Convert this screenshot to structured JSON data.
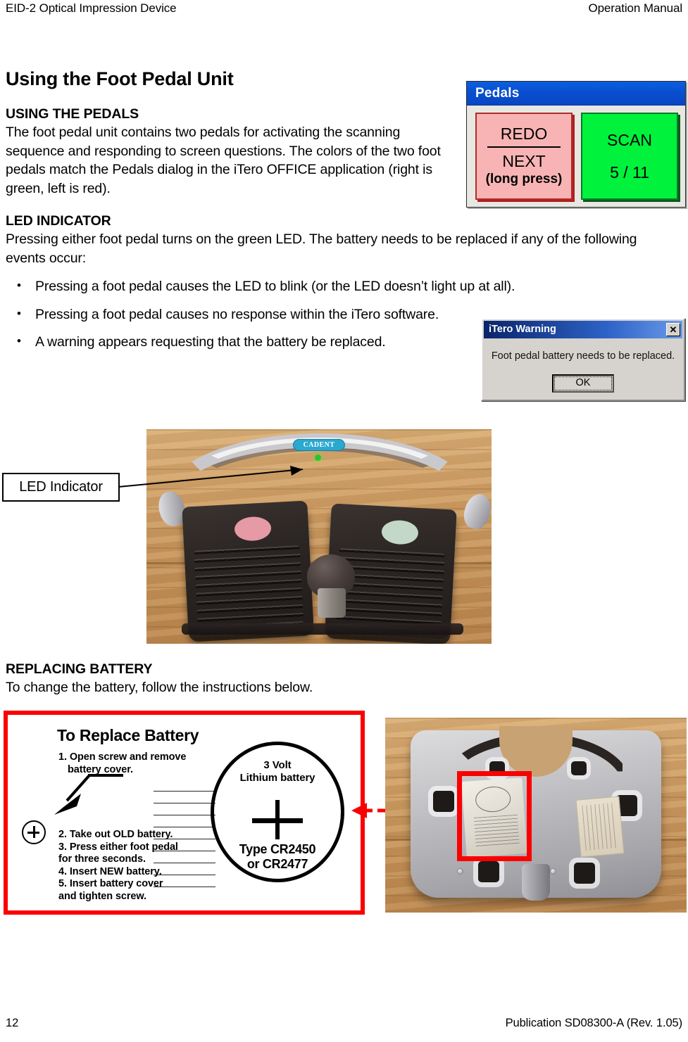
{
  "header": {
    "left": "EID-2 Optical Impression Device",
    "right": "Operation Manual"
  },
  "main": {
    "title": "Using the Foot Pedal Unit",
    "sections": [
      {
        "heading": "USING THE PEDALS",
        "body": "The foot pedal unit contains two pedals for activating the scanning sequence and responding to screen questions. The colors of the two foot pedals match the Pedals dialog in the iTero OFFICE application (right is green, left is red)."
      },
      {
        "heading": "LED INDICATOR",
        "body": "Pressing either foot pedal turns on the green LED. The battery needs to be replaced if any of the following events occur:"
      },
      {
        "heading": "REPLACING BATTERY",
        "body": "To change the battery, follow the instructions below."
      }
    ],
    "bullets": [
      "Pressing a foot pedal causes the LED to blink (or the LED doesn’t light up at all).",
      "Pressing a foot pedal causes no response within the iTero software.",
      "A warning appears requesting that the battery be replaced."
    ]
  },
  "pedals_dialog": {
    "title": "Pedals",
    "left_button": {
      "primary": "REDO",
      "secondary": "NEXT",
      "hint": "(long press)",
      "color": "#f8b4b4",
      "border_color": "#b22b2b"
    },
    "right_button": {
      "primary": "SCAN",
      "counter": "5 / 11",
      "color": "#00f23c",
      "border_color": "#0a7a28"
    },
    "titlebar_color": "#0b5fe0"
  },
  "warning_dialog": {
    "title": "iTero Warning",
    "close_label": "✕",
    "message": "Foot pedal battery needs to be replaced.",
    "ok_label": "OK",
    "titlebar_color": "#0a246a"
  },
  "photo_top": {
    "callout_label": "LED Indicator",
    "brand_logo": "CADENT",
    "left_pedal_marker_color": "#e59aa6",
    "right_pedal_marker_color": "#c3d8c7",
    "led_color": "#2ec12e"
  },
  "battery_panel": {
    "title": "To Replace Battery",
    "steps_group_1": [
      {
        "num": "1.",
        "text": "Open screw and remove",
        "cont": "battery cover."
      }
    ],
    "steps_group_2": [
      {
        "num": "2.",
        "text": "Take out OLD battery.",
        "cont": ""
      },
      {
        "num": "3.",
        "text": "Press either foot pedal",
        "cont": "for three seconds."
      },
      {
        "num": "4.",
        "text": "Insert NEW battery.",
        "cont": ""
      },
      {
        "num": "5.",
        "text": "Insert battery cover",
        "cont": "and tighten screw."
      }
    ],
    "battery_line_1": "3 Volt",
    "battery_line_2": "Lithium battery",
    "battery_type_1": "Type  CR2450",
    "battery_type_2": "or CR2477",
    "border_color": "#fb0000"
  },
  "footer": {
    "page_number": "12",
    "publication": "Publication SD08300-A  (Rev. 1.05)"
  }
}
